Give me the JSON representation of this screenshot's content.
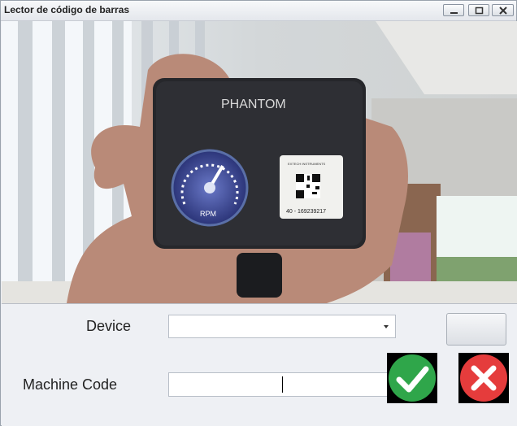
{
  "window": {
    "title": "Lector de código de barras",
    "controls": [
      "minimize-icon",
      "maximize-icon",
      "close-icon"
    ]
  },
  "camera": {
    "device_brand_text": "PHANTOM",
    "gauge_label": "RPM",
    "sticker_brand": "EXTECH INSTRUMENTS",
    "sticker_serial": "40 - 169239217"
  },
  "form": {
    "device_label": "Device",
    "device_value": "",
    "machine_code_label": "Machine Code",
    "machine_code_value": ""
  },
  "actions": {
    "blank_button_label": "",
    "confirm_icon": "checkmark-icon",
    "cancel_icon": "cross-icon"
  }
}
